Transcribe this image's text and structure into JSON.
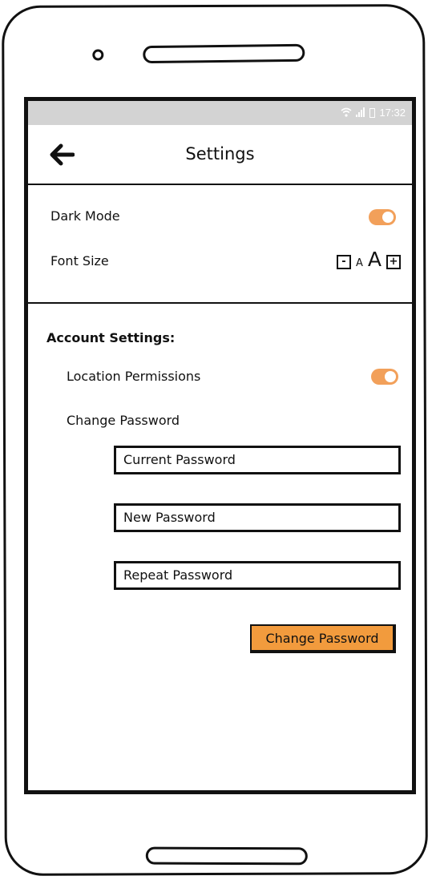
{
  "status_bar": {
    "time": "17:32",
    "wifi_icon": "wifi-icon",
    "signal_icon": "signal-icon",
    "battery_icon": "battery-icon"
  },
  "header": {
    "title": "Settings",
    "back_icon": "back-arrow-icon"
  },
  "preferences": {
    "dark_mode_label": "Dark Mode",
    "dark_mode_on": true,
    "font_size_label": "Font Size",
    "font_decrease": "-",
    "font_small_glyph": "A",
    "font_large_glyph": "A",
    "font_increase": "+"
  },
  "account": {
    "title": "Account Settings:",
    "location_label": "Location Permissions",
    "location_on": true,
    "change_password_label": "Change Password",
    "fields": {
      "current": "Current Password",
      "new": "New Password",
      "repeat": "Repeat Password"
    },
    "submit_label": "Change Password"
  },
  "colors": {
    "toggle_on": "#f2a05a",
    "button_bg": "#f29b3d",
    "status_bar_bg": "#d3d3d3"
  }
}
